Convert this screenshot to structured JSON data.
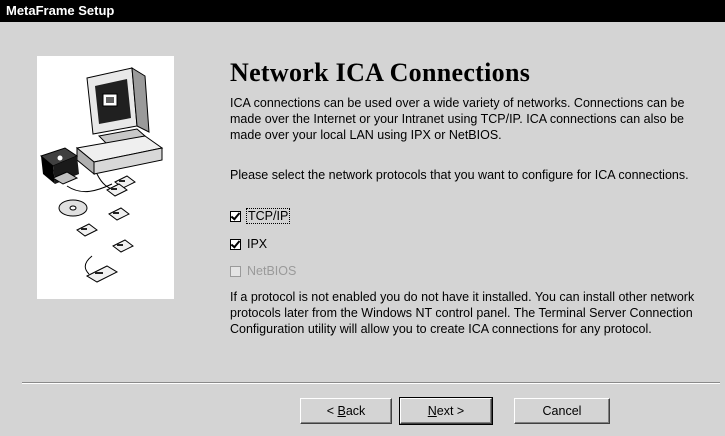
{
  "window": {
    "title": "MetaFrame Setup"
  },
  "page": {
    "heading": "Network ICA Connections",
    "intro": "ICA connections can be used over a wide variety of networks.  Connections can be made over the Internet or your Intranet using TCP/IP. ICA connections can also be made over your local LAN using IPX or NetBIOS.",
    "prompt": "Please select the network protocols that you want to configure for ICA connections.",
    "note": "If a protocol is not enabled you do not have it installed.  You can install other network protocols later from the Windows NT control panel.  The Terminal Server Connection Configuration utility will allow you to create ICA connections for any protocol."
  },
  "protocols": [
    {
      "label": "TCP/IP",
      "checked": true,
      "enabled": true,
      "focused": true
    },
    {
      "label": "IPX",
      "checked": true,
      "enabled": true,
      "focused": false
    },
    {
      "label": "NetBIOS",
      "checked": false,
      "enabled": false,
      "focused": false
    }
  ],
  "buttons": {
    "back_prefix": "< ",
    "back_mnemonic": "B",
    "back_rest": "ack",
    "next_mnemonic": "N",
    "next_rest": "ext >",
    "cancel": "Cancel"
  },
  "icons": [
    "computer-network-illustration",
    "checkbox"
  ]
}
